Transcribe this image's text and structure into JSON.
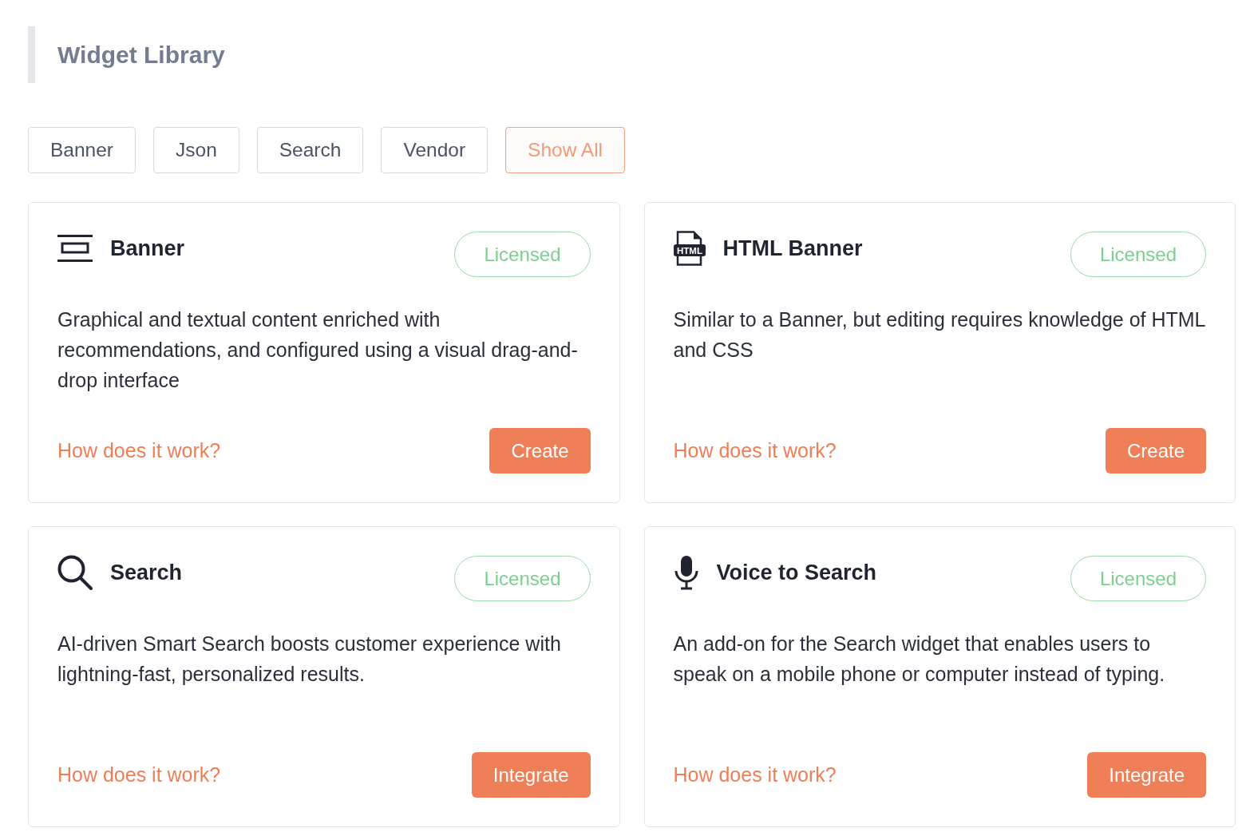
{
  "header": {
    "title": "Widget Library"
  },
  "filters": [
    {
      "label": "Banner",
      "selected": false
    },
    {
      "label": "Json",
      "selected": false
    },
    {
      "label": "Search",
      "selected": false
    },
    {
      "label": "Vendor",
      "selected": false
    },
    {
      "label": "Show All",
      "selected": true
    }
  ],
  "cards": [
    {
      "kind": "banner",
      "title": "Banner",
      "badge": "Licensed",
      "description": "Graphical and textual content enriched with recommendations, and configured using a visual drag-and-drop interface",
      "link": "How does it work?",
      "action": "Create"
    },
    {
      "kind": "html-banner",
      "icon_label": "HTML",
      "title": "HTML Banner",
      "badge": "Licensed",
      "description": "Similar to a Banner, but editing requires knowledge of HTML and CSS",
      "link": "How does it work?",
      "action": "Create"
    },
    {
      "kind": "search",
      "title": "Search",
      "badge": "Licensed",
      "description": "AI-driven Smart Search boosts customer experience with lightning-fast, personalized results.",
      "link": "How does it work?",
      "action": "Integrate"
    },
    {
      "kind": "voice",
      "title": "Voice to Search",
      "badge": "Licensed",
      "description": "An add-on for the Search widget that enables users to speak on a mobile phone or computer instead of typing.",
      "link": "How does it work?",
      "action": "Integrate"
    }
  ]
}
